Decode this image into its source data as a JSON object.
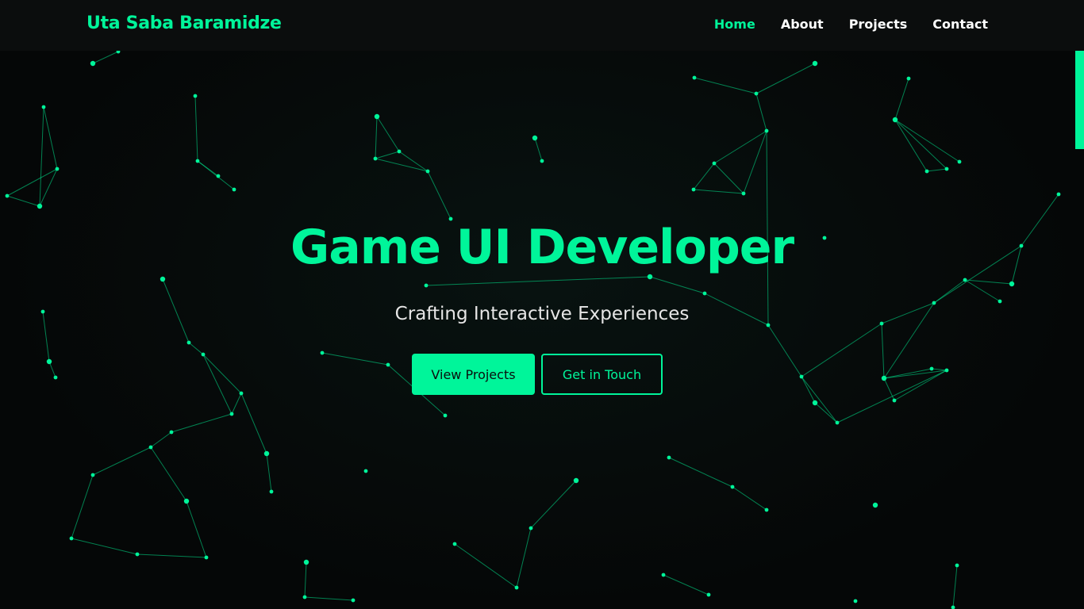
{
  "header": {
    "logo": "Uta Saba Baramidze",
    "nav": [
      {
        "label": "Home",
        "active": true
      },
      {
        "label": "About",
        "active": false
      },
      {
        "label": "Projects",
        "active": false
      },
      {
        "label": "Contact",
        "active": false
      }
    ]
  },
  "hero": {
    "title": "Game UI Developer",
    "subtitle": "Crafting Interactive Experiences",
    "primary_button": "View Projects",
    "secondary_button": "Get in Touch"
  },
  "colors": {
    "accent": "#00f59a",
    "background": "#050707",
    "navbar": "#0b0d0d",
    "subtitle": "#e6e6e6"
  }
}
